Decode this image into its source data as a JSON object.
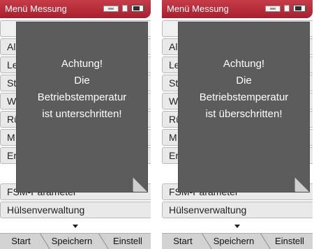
{
  "screens": [
    {
      "title": "Menü Messung",
      "menu_items": [
        "",
        "Al",
        "Le",
        "St",
        "W",
        "Rü",
        "M",
        "Er",
        "FSM-Parameter",
        "Hülsenverwaltung"
      ],
      "menu_suffix": ")",
      "dialog": {
        "line1": "Achtung!",
        "line2": "Die",
        "line3": "Betriebstemperatur",
        "line4": "ist unterschritten!"
      },
      "softkeys": [
        "Start",
        "Speichern",
        "Einstell"
      ],
      "icons": [
        "memory-icon",
        "card-icon",
        "battery-icon",
        "scroll-down-icon",
        "page-curl-icon"
      ]
    },
    {
      "title": "Menü Messung",
      "menu_items": [
        "",
        "Al",
        "Le",
        "St",
        "W",
        "Rü",
        "M",
        "Er",
        "FSM-Parameter",
        "Hülsenverwaltung"
      ],
      "menu_suffix": ")",
      "dialog": {
        "line1": "Achtung!",
        "line2": "Die",
        "line3": "Betriebstemperatur",
        "line4": "ist überschritten!"
      },
      "softkeys": [
        "Start",
        "Speichern",
        "Einstell"
      ],
      "icons": [
        "memory-icon",
        "card-icon",
        "battery-icon",
        "scroll-down-icon",
        "page-curl-icon"
      ]
    }
  ],
  "colors": {
    "titlebar": "#b82b38",
    "dialog": "#5c5c5c",
    "menu_item": "#e9e9e9",
    "softkey_bar": "#d2d2d2"
  }
}
